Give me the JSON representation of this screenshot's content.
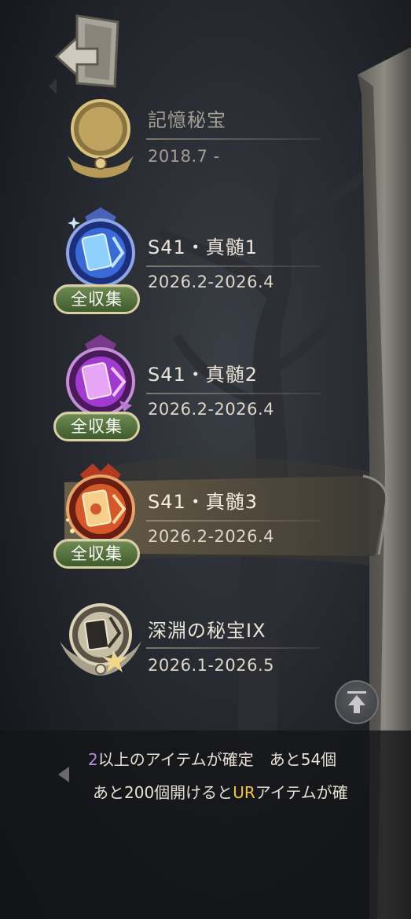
{
  "back_button": {
    "icon": "exit-door-arrow-icon"
  },
  "collections": [
    {
      "title": "記憶秘宝",
      "dates": "2018.7 -",
      "badge": "gold-moon-emblem",
      "complete_label": ""
    },
    {
      "title": "S41・真髄1",
      "dates": "2026.2-2026.4",
      "badge": "blue-card-emblem",
      "complete_label": "全収集"
    },
    {
      "title": "S41・真髄2",
      "dates": "2026.2-2026.4",
      "badge": "purple-card-emblem",
      "complete_label": "全収集"
    },
    {
      "title": "S41・真髄3",
      "dates": "2026.2-2026.4",
      "badge": "red-card-emblem",
      "complete_label": "全収集",
      "selected": true
    },
    {
      "title": "深淵の秘宝IX",
      "dates": "2026.1-2026.5",
      "badge": "silver-winged-emblem",
      "complete_label": ""
    }
  ],
  "scroll_top_button": {
    "icon": "arrow-up-icon"
  },
  "notice": {
    "line1_prefix": "2",
    "line1_text": "以上のアイテムが確定　あと54個",
    "line2_before": "あと200個開けると",
    "line2_highlight": "UR",
    "line2_after": "アイテムが確"
  },
  "colors": {
    "pill_green": "#4f6e3a",
    "pill_border": "#d9cfa6",
    "highlight_text": "#f5c542",
    "selected_row": "#5a4f3e"
  }
}
